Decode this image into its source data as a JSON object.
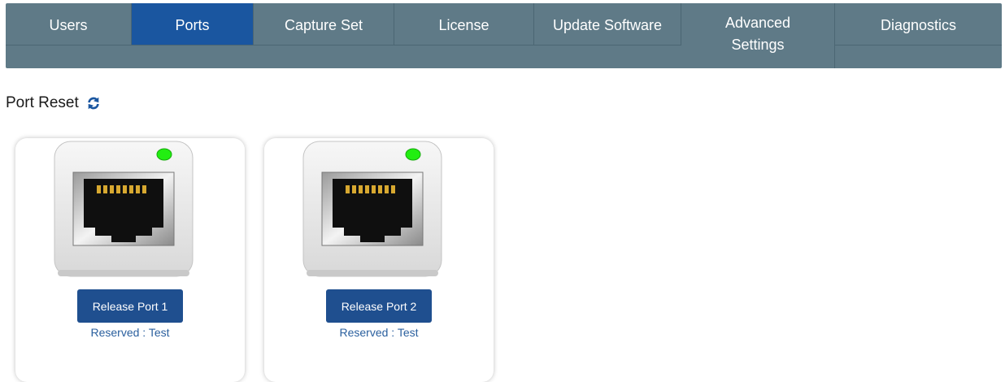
{
  "tabs": [
    {
      "label": "Users"
    },
    {
      "label": "Ports"
    },
    {
      "label": "Capture Set"
    },
    {
      "label": "License"
    },
    {
      "label": "Update Software"
    },
    {
      "label": "Advanced\nSettings"
    },
    {
      "label": "Diagnostics"
    }
  ],
  "active_tab": "Ports",
  "section": {
    "title": "Port Reset",
    "refresh_icon": "refresh-icon"
  },
  "ports": [
    {
      "button_label": "Release Port 1",
      "status": "Reserved : Test",
      "led_color": "#22ee11"
    },
    {
      "button_label": "Release Port 2",
      "status": "Reserved : Test",
      "led_color": "#22ee11"
    }
  ],
  "colors": {
    "tabbar": "#5f7a87",
    "active_tab": "#1a56a0",
    "button": "#1f4f8f",
    "status_text": "#2a5f9e"
  }
}
